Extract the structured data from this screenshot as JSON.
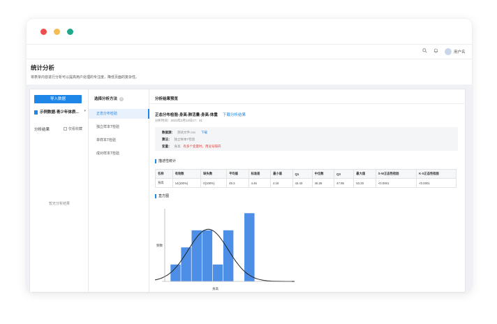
{
  "topbar": {
    "username": "用户名"
  },
  "page": {
    "title": "统计分析",
    "description": "将表单内容进行分析可以提高用户处理的专注度，降低页面的复杂性。"
  },
  "left": {
    "import_button": "导入数据",
    "file_name": "示例数据-青少年体质...",
    "results_label": "分析结果",
    "only_favorites": "仅看收藏",
    "empty_text": "暂无分析结果"
  },
  "methods": {
    "header": "选择分析方法",
    "items": [
      {
        "label": "正态分布检验",
        "active": true
      },
      {
        "label": "独立样本T检验",
        "active": false
      },
      {
        "label": "单样本T检验",
        "active": false
      },
      {
        "label": "成对样本T检验",
        "active": false
      }
    ]
  },
  "results": {
    "header": "分析结果预览",
    "title": "正态分布检验-身高-肺活量-身高-体重",
    "download_link": "下载分析结果",
    "time": "分析时间：2023年2月14日17：31",
    "info": {
      "dataset_key": "数据源：",
      "dataset_val": "测试文件.csv",
      "dataset_link": "下载",
      "algo_key": "算法：",
      "algo_val": "独立样本T检验",
      "var_key": "变量：",
      "var_val": "身高",
      "var_warn": "有多个变量时，用逗号隔开"
    },
    "desc_section": "描述性统计",
    "table": {
      "headers": [
        "名称",
        "有效数",
        "缺失数",
        "平均值",
        "标准差",
        "最小值",
        "Q1",
        "中位数",
        "Q3",
        "最大值",
        "S-W正态性检验",
        "K-S正态性检验"
      ],
      "rows": [
        [
          "身高",
          "14(100%)",
          "0(100%)",
          "45.3",
          "4.45",
          "4.16",
          "43.43",
          "45.28",
          "47.95",
          "53.20",
          "<0.0001",
          "<0.0001"
        ]
      ]
    },
    "hist_section": "直方图"
  },
  "chart_data": {
    "type": "bar",
    "title": "",
    "xlabel": "身高",
    "ylabel": "频数",
    "bar_color": "#4d8ee6",
    "curve": "normal",
    "values": [
      1,
      2,
      3,
      3,
      1,
      3,
      0,
      4,
      0
    ],
    "ylim": [
      0,
      4
    ]
  }
}
